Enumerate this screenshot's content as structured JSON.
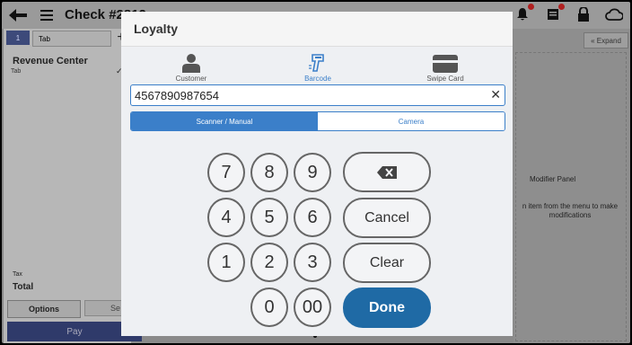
{
  "topbar": {
    "title": "Check #2812"
  },
  "tabs": {
    "selected": "1",
    "tab_label": "Tab",
    "add_label": "+"
  },
  "left": {
    "revenue_center": "Revenue Center",
    "sub": "Tab",
    "check": "✓",
    "tax": "Tax",
    "total": "Total",
    "options": "Options",
    "send": "Se",
    "pay": "Pay"
  },
  "right": {
    "expand": "« Expand",
    "modifier_title": "Modifier Panel",
    "modifier_hint": "n item from the menu to make modifications"
  },
  "modal": {
    "title": "Loyalty",
    "sources": [
      {
        "label": "Customer",
        "icon": "person-icon"
      },
      {
        "label": "Barcode",
        "icon": "barcode-scanner-icon"
      },
      {
        "label": "Swipe Card",
        "icon": "card-icon"
      }
    ],
    "input_value": "4567890987654",
    "modes": [
      "Scanner / Manual",
      "Camera"
    ],
    "keys": [
      "7",
      "8",
      "9",
      "4",
      "5",
      "6",
      "1",
      "2",
      "3",
      "0",
      "00"
    ],
    "actions": {
      "cancel": "Cancel",
      "clear": "Clear",
      "done": "Done"
    }
  },
  "colors": {
    "accent": "#3b7fc9",
    "done": "#1f6aa5",
    "pay": "#2f3a6a"
  }
}
